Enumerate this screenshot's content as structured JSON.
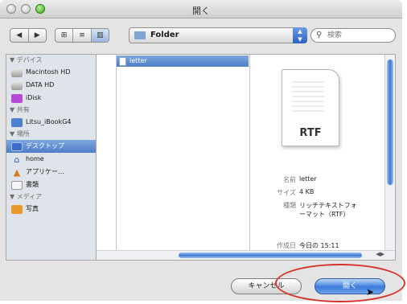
{
  "window": {
    "title": "開く"
  },
  "toolbar": {
    "nav_back": "◀",
    "nav_forward": "▶",
    "view_icon": "⊞",
    "view_list": "≡",
    "view_column": "▥",
    "location": "Folder",
    "search_placeholder": "検索"
  },
  "sidebar": {
    "sections": [
      {
        "title": "▼ デバイス",
        "items": [
          {
            "label": "Macintosh HD",
            "icon": "drive-icon"
          },
          {
            "label": "DATA HD",
            "icon": "drive-icon"
          },
          {
            "label": "iDisk",
            "icon": "idisk-icon"
          }
        ]
      },
      {
        "title": "▼ 共有",
        "items": [
          {
            "label": "Litsu_iBookG4",
            "icon": "network-computer-icon"
          }
        ]
      },
      {
        "title": "▼ 場所",
        "items": [
          {
            "label": "デスクトップ",
            "icon": "desktop-icon",
            "selected": true
          },
          {
            "label": "home",
            "icon": "home-icon"
          },
          {
            "label": "アプリケー…",
            "icon": "applications-icon"
          },
          {
            "label": "書類",
            "icon": "documents-icon"
          }
        ]
      },
      {
        "title": "▼ メディア",
        "items": [
          {
            "label": "写真",
            "icon": "photos-icon"
          }
        ]
      }
    ]
  },
  "browser": {
    "selected_file": "letter",
    "preview": {
      "ext": "RTF",
      "name_label": "名前",
      "name_value": "letter",
      "size_label": "サイズ",
      "size_value": "4 KB",
      "kind_label": "種類",
      "kind_value": "リッチテキストフォーマット（RTF）",
      "created_label": "作成日",
      "created_value": "今日の 15:11"
    }
  },
  "buttons": {
    "cancel": "キャンセル",
    "open": "開く"
  },
  "colors": {
    "accent": "#3b7ad9",
    "highlight_oval": "#d6322a"
  }
}
